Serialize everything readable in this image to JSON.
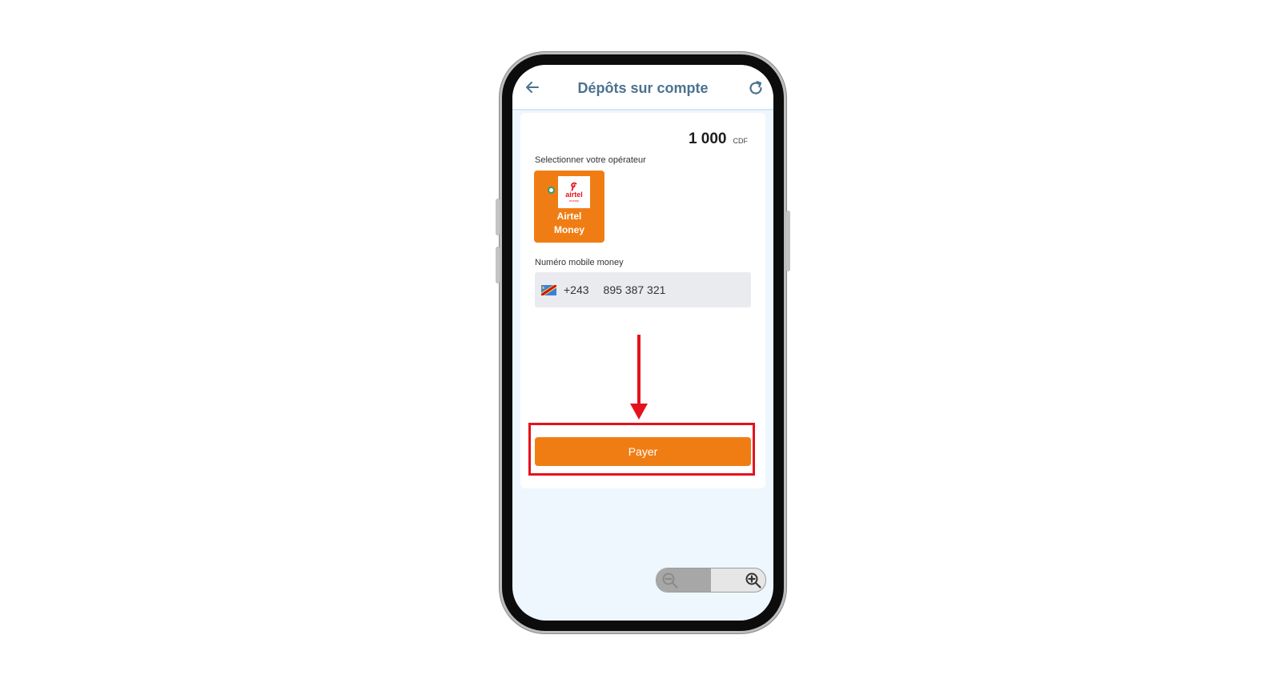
{
  "header": {
    "title": "Dépôts sur compte",
    "back_icon": "arrow-left-icon",
    "refresh_icon": "refresh-icon"
  },
  "amount": {
    "value": "1 000",
    "currency": "CDF"
  },
  "operator_section": {
    "label": "Selectionner votre opérateur",
    "selected_operator": {
      "name": "Airtel\nMoney",
      "logo_text": "airtel",
      "logo_subtext": "money"
    }
  },
  "phone_section": {
    "label": "Numéro mobile money",
    "dial_code": "+243",
    "number": "895 387 321",
    "flag_icon": "drc-flag-icon"
  },
  "pay_button": {
    "label": "Payer"
  },
  "annotation": {
    "arrow_icon": "arrow-down-icon",
    "highlight_color": "#e5121d"
  },
  "zoom_control": {
    "out_icon": "zoom-out-icon",
    "in_icon": "zoom-in-icon"
  },
  "colors": {
    "accent": "#f07d14",
    "title": "#4b7290",
    "screen_bg": "#eef7fd"
  }
}
